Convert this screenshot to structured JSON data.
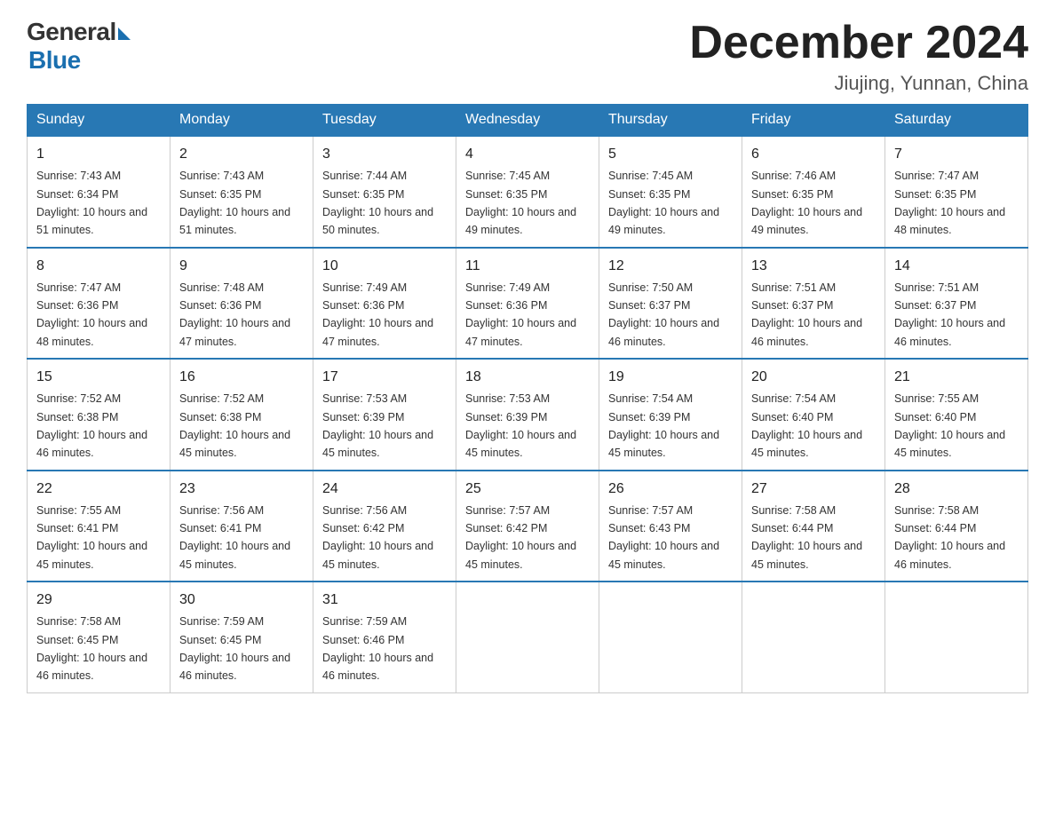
{
  "logo": {
    "text_general": "General",
    "text_blue": "Blue"
  },
  "title": "December 2024",
  "location": "Jiujing, Yunnan, China",
  "days_of_week": [
    "Sunday",
    "Monday",
    "Tuesday",
    "Wednesday",
    "Thursday",
    "Friday",
    "Saturday"
  ],
  "weeks": [
    [
      {
        "day": "1",
        "sunrise": "7:43 AM",
        "sunset": "6:34 PM",
        "daylight": "10 hours and 51 minutes."
      },
      {
        "day": "2",
        "sunrise": "7:43 AM",
        "sunset": "6:35 PM",
        "daylight": "10 hours and 51 minutes."
      },
      {
        "day": "3",
        "sunrise": "7:44 AM",
        "sunset": "6:35 PM",
        "daylight": "10 hours and 50 minutes."
      },
      {
        "day": "4",
        "sunrise": "7:45 AM",
        "sunset": "6:35 PM",
        "daylight": "10 hours and 49 minutes."
      },
      {
        "day": "5",
        "sunrise": "7:45 AM",
        "sunset": "6:35 PM",
        "daylight": "10 hours and 49 minutes."
      },
      {
        "day": "6",
        "sunrise": "7:46 AM",
        "sunset": "6:35 PM",
        "daylight": "10 hours and 49 minutes."
      },
      {
        "day": "7",
        "sunrise": "7:47 AM",
        "sunset": "6:35 PM",
        "daylight": "10 hours and 48 minutes."
      }
    ],
    [
      {
        "day": "8",
        "sunrise": "7:47 AM",
        "sunset": "6:36 PM",
        "daylight": "10 hours and 48 minutes."
      },
      {
        "day": "9",
        "sunrise": "7:48 AM",
        "sunset": "6:36 PM",
        "daylight": "10 hours and 47 minutes."
      },
      {
        "day": "10",
        "sunrise": "7:49 AM",
        "sunset": "6:36 PM",
        "daylight": "10 hours and 47 minutes."
      },
      {
        "day": "11",
        "sunrise": "7:49 AM",
        "sunset": "6:36 PM",
        "daylight": "10 hours and 47 minutes."
      },
      {
        "day": "12",
        "sunrise": "7:50 AM",
        "sunset": "6:37 PM",
        "daylight": "10 hours and 46 minutes."
      },
      {
        "day": "13",
        "sunrise": "7:51 AM",
        "sunset": "6:37 PM",
        "daylight": "10 hours and 46 minutes."
      },
      {
        "day": "14",
        "sunrise": "7:51 AM",
        "sunset": "6:37 PM",
        "daylight": "10 hours and 46 minutes."
      }
    ],
    [
      {
        "day": "15",
        "sunrise": "7:52 AM",
        "sunset": "6:38 PM",
        "daylight": "10 hours and 46 minutes."
      },
      {
        "day": "16",
        "sunrise": "7:52 AM",
        "sunset": "6:38 PM",
        "daylight": "10 hours and 45 minutes."
      },
      {
        "day": "17",
        "sunrise": "7:53 AM",
        "sunset": "6:39 PM",
        "daylight": "10 hours and 45 minutes."
      },
      {
        "day": "18",
        "sunrise": "7:53 AM",
        "sunset": "6:39 PM",
        "daylight": "10 hours and 45 minutes."
      },
      {
        "day": "19",
        "sunrise": "7:54 AM",
        "sunset": "6:39 PM",
        "daylight": "10 hours and 45 minutes."
      },
      {
        "day": "20",
        "sunrise": "7:54 AM",
        "sunset": "6:40 PM",
        "daylight": "10 hours and 45 minutes."
      },
      {
        "day": "21",
        "sunrise": "7:55 AM",
        "sunset": "6:40 PM",
        "daylight": "10 hours and 45 minutes."
      }
    ],
    [
      {
        "day": "22",
        "sunrise": "7:55 AM",
        "sunset": "6:41 PM",
        "daylight": "10 hours and 45 minutes."
      },
      {
        "day": "23",
        "sunrise": "7:56 AM",
        "sunset": "6:41 PM",
        "daylight": "10 hours and 45 minutes."
      },
      {
        "day": "24",
        "sunrise": "7:56 AM",
        "sunset": "6:42 PM",
        "daylight": "10 hours and 45 minutes."
      },
      {
        "day": "25",
        "sunrise": "7:57 AM",
        "sunset": "6:42 PM",
        "daylight": "10 hours and 45 minutes."
      },
      {
        "day": "26",
        "sunrise": "7:57 AM",
        "sunset": "6:43 PM",
        "daylight": "10 hours and 45 minutes."
      },
      {
        "day": "27",
        "sunrise": "7:58 AM",
        "sunset": "6:44 PM",
        "daylight": "10 hours and 45 minutes."
      },
      {
        "day": "28",
        "sunrise": "7:58 AM",
        "sunset": "6:44 PM",
        "daylight": "10 hours and 46 minutes."
      }
    ],
    [
      {
        "day": "29",
        "sunrise": "7:58 AM",
        "sunset": "6:45 PM",
        "daylight": "10 hours and 46 minutes."
      },
      {
        "day": "30",
        "sunrise": "7:59 AM",
        "sunset": "6:45 PM",
        "daylight": "10 hours and 46 minutes."
      },
      {
        "day": "31",
        "sunrise": "7:59 AM",
        "sunset": "6:46 PM",
        "daylight": "10 hours and 46 minutes."
      },
      null,
      null,
      null,
      null
    ]
  ]
}
